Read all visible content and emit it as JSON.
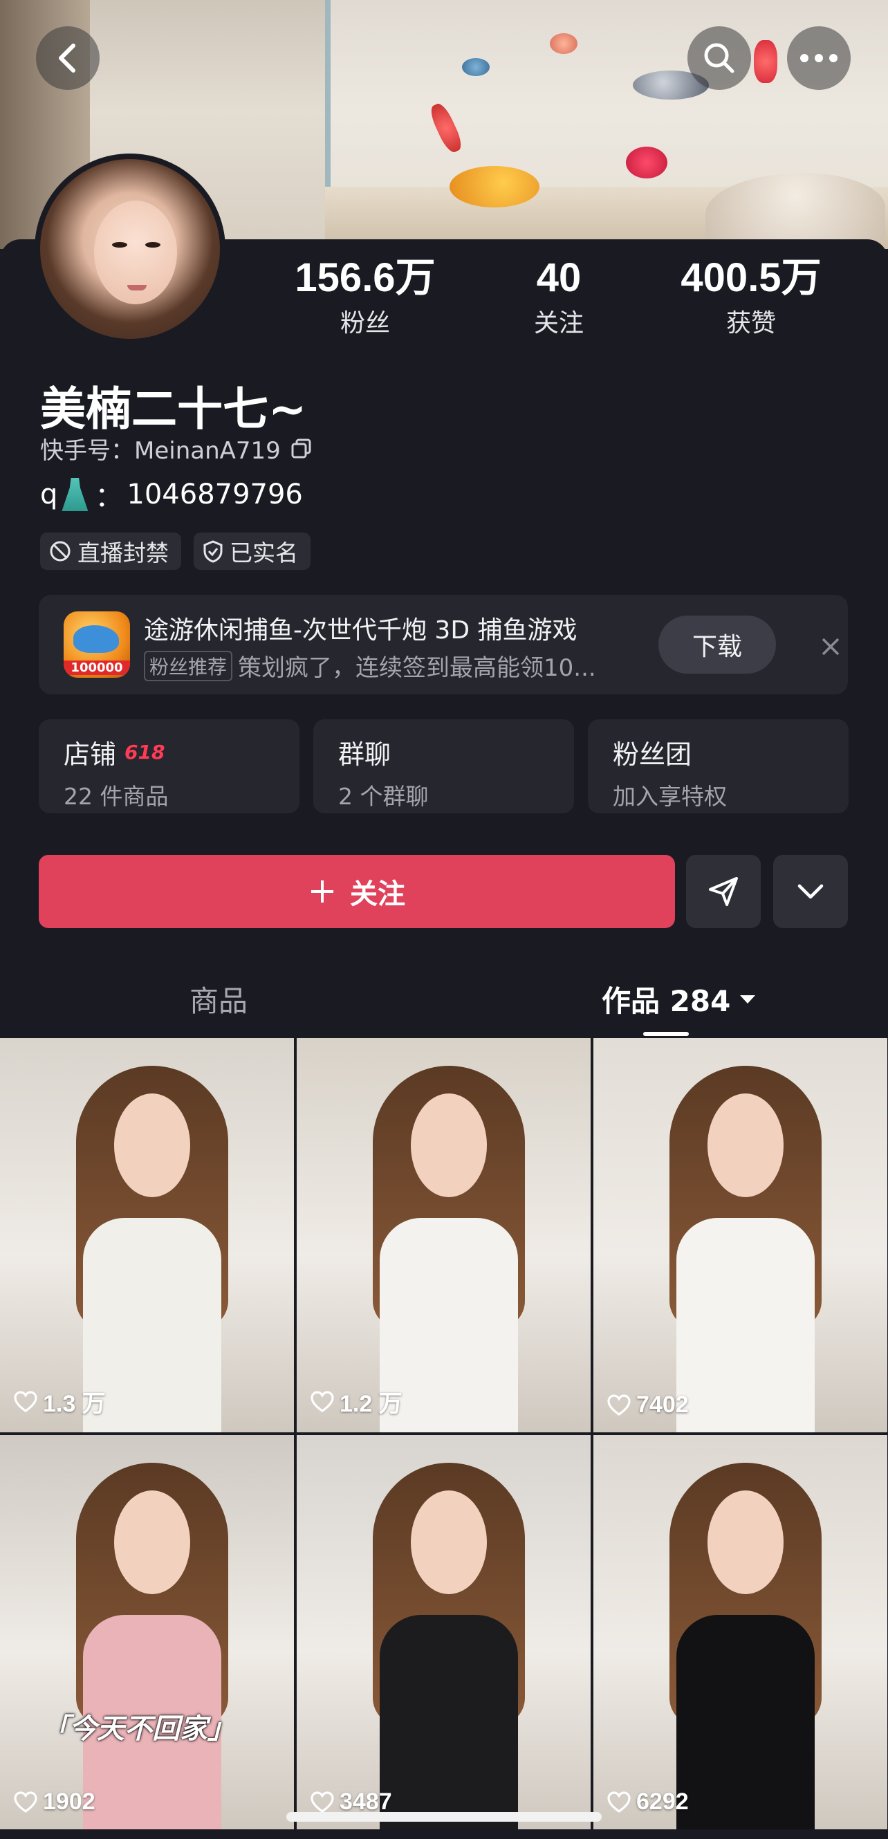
{
  "header": {
    "back_icon": "chevron-left-icon",
    "search_icon": "search-icon",
    "more_icon": "more-icon"
  },
  "profile": {
    "name": "美楠二十七~",
    "uid_label": "快手号：MeinanA719",
    "bio_prefix": "q",
    "bio_sep": "：",
    "bio_number": "1046879796",
    "stats": [
      {
        "value": "156.6万",
        "label": "粉丝"
      },
      {
        "value": "40",
        "label": "关注"
      },
      {
        "value": "400.5万",
        "label": "获赞"
      }
    ],
    "tags": [
      {
        "icon": "ban-icon",
        "label": "直播封禁"
      },
      {
        "icon": "shield-check-icon",
        "label": "已实名"
      }
    ]
  },
  "ad": {
    "icon_badge": "100000",
    "title": "途游休闲捕鱼-次世代千炮 3D 捕鱼游戏",
    "pill": "粉丝推荐",
    "subtitle": "策划疯了，连续签到最高能领10...",
    "download_label": "下载"
  },
  "cards": [
    {
      "title": "店铺",
      "badge": "618",
      "subtitle": "22 件商品"
    },
    {
      "title": "群聊",
      "badge": "",
      "subtitle": "2 个群聊"
    },
    {
      "title": "粉丝团",
      "badge": "",
      "subtitle": "加入享特权"
    }
  ],
  "actions": {
    "follow_label": "关注",
    "share_icon": "send-icon",
    "dropdown_icon": "chevron-down-icon"
  },
  "tabs": {
    "goods": "商品",
    "works": "作品 284"
  },
  "grid": [
    {
      "likes": "1.3 万",
      "caption": "",
      "colors": [
        "#d9d4cc",
        "#f0efe9"
      ]
    },
    {
      "likes": "1.2 万",
      "caption": "",
      "colors": [
        "#d8d2c8",
        "#f4f2ee"
      ]
    },
    {
      "likes": "7402",
      "caption": "",
      "colors": [
        "#e2ddd6",
        "#f5f3ef"
      ]
    },
    {
      "likes": "1902",
      "caption": "「今天不回家」",
      "colors": [
        "#cfcac3",
        "#e9b3b8"
      ]
    },
    {
      "likes": "3487",
      "caption": "",
      "colors": [
        "#d8d4cf",
        "#1c1c1e"
      ]
    },
    {
      "likes": "6292",
      "caption": "",
      "colors": [
        "#ddd8d1",
        "#121214"
      ]
    }
  ]
}
